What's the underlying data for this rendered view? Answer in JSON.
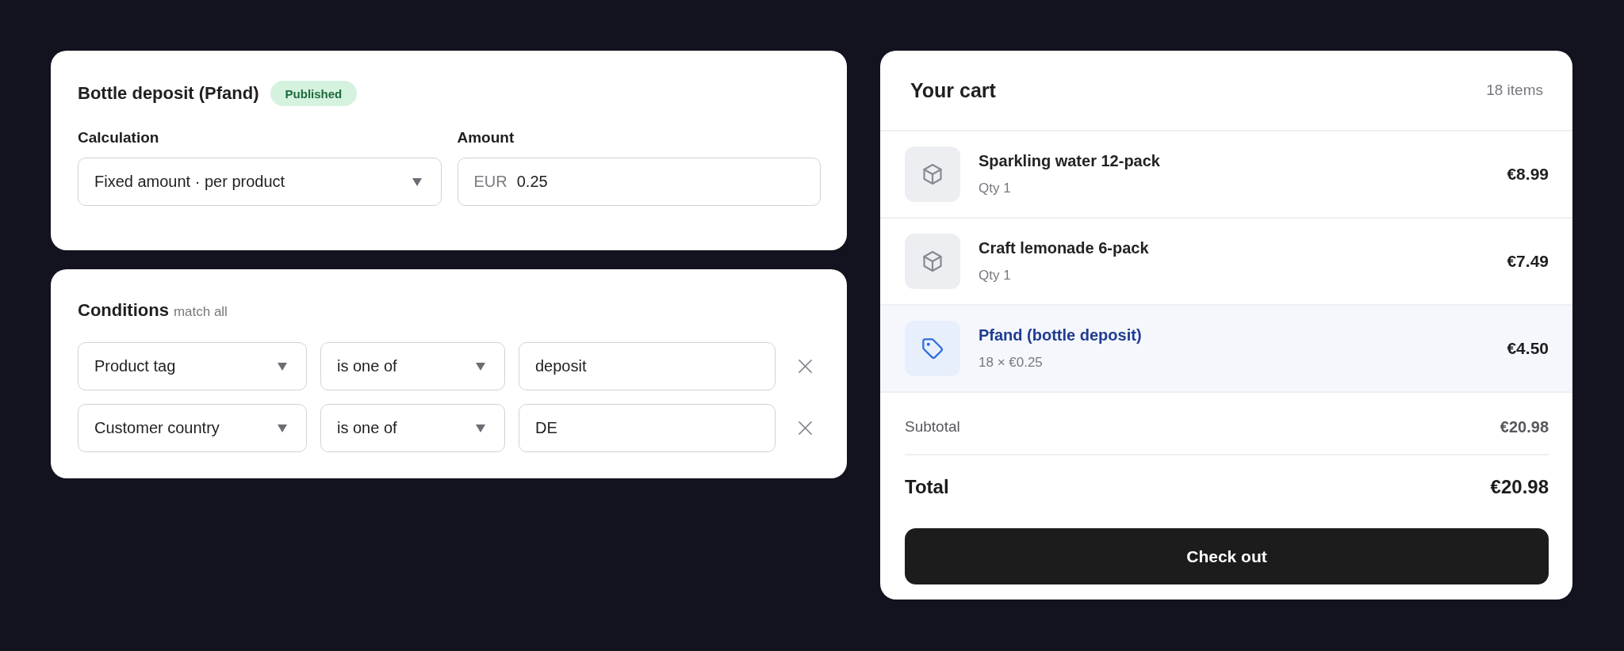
{
  "rule": {
    "title": "Bottle deposit (Pfand)",
    "status": "Published",
    "calculation": {
      "label": "Calculation",
      "value": "Fixed amount · per product"
    },
    "amount": {
      "label": "Amount",
      "prefix": "EUR",
      "value": "0.25"
    }
  },
  "conditions": {
    "title": "Conditions",
    "hint": "match all",
    "rows": [
      {
        "field": "Product tag",
        "operator": "is one of",
        "value": "deposit"
      },
      {
        "field": "Customer country",
        "operator": "is one of",
        "value": "DE"
      }
    ]
  },
  "cart": {
    "title": "Your cart",
    "count": "18 items",
    "items": [
      {
        "kind": "product",
        "name": "Sparkling water 12-pack",
        "detail": "Qty 1",
        "price": "€8.99"
      },
      {
        "kind": "product",
        "name": "Craft lemonade 6-pack",
        "detail": "Qty 1",
        "price": "€7.49"
      },
      {
        "kind": "deposit",
        "name": "Pfand (bottle deposit)",
        "detail": "18 × €0.25",
        "price": "€4.50"
      }
    ],
    "subtotal": {
      "label": "Subtotal",
      "value": "€20.98"
    },
    "total": {
      "label": "Total",
      "value": "€20.98"
    },
    "checkout": "Check out"
  }
}
